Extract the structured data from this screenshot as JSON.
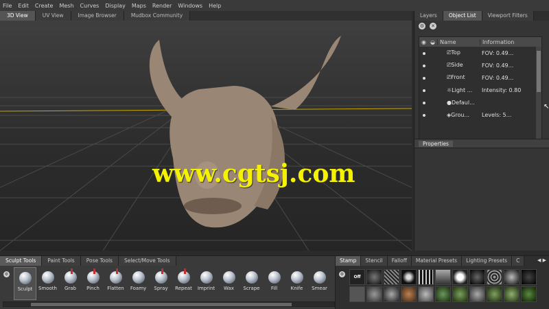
{
  "menu": [
    "File",
    "Edit",
    "Create",
    "Mesh",
    "Curves",
    "Display",
    "Maps",
    "Render",
    "Windows",
    "Help"
  ],
  "viewport_tabs": [
    {
      "label": "3D View",
      "active": true
    },
    {
      "label": "UV View",
      "active": false
    },
    {
      "label": "Image Browser",
      "active": false
    },
    {
      "label": "Mudbox Community",
      "active": false
    }
  ],
  "watermark": "www.cgtsj.com",
  "right_tabs": [
    {
      "label": "Layers",
      "active": false
    },
    {
      "label": "Object List",
      "active": true
    },
    {
      "label": "Viewport Filters",
      "active": false
    }
  ],
  "object_list": {
    "col_name": "Name",
    "col_info": "Information",
    "rows": [
      {
        "name": "Top",
        "info": "FOV: 0.49...",
        "icon": "camera-icon"
      },
      {
        "name": "Side",
        "info": "FOV: 0.49...",
        "icon": "camera-icon"
      },
      {
        "name": "Front",
        "info": "FOV: 0.49...",
        "icon": "camera-icon"
      },
      {
        "name": "Light ...",
        "info": "Intensity: 0.80",
        "icon": "light-icon"
      },
      {
        "name": "Defaul...",
        "info": "",
        "icon": "material-icon"
      },
      {
        "name": "Grou...",
        "info": "Levels: 5...",
        "icon": "mesh-icon"
      }
    ]
  },
  "properties_label": "Properties",
  "tool_tabs": [
    {
      "label": "Sculpt Tools",
      "active": true
    },
    {
      "label": "Paint Tools",
      "active": false
    },
    {
      "label": "Pose Tools",
      "active": false
    },
    {
      "label": "Select/Move Tools",
      "active": false
    }
  ],
  "tools": [
    {
      "label": "Sculpt",
      "active": true
    },
    {
      "label": "Smooth",
      "active": false
    },
    {
      "label": "Grab",
      "active": false
    },
    {
      "label": "Pinch",
      "active": false
    },
    {
      "label": "Flatten",
      "active": false
    },
    {
      "label": "Foamy",
      "active": false
    },
    {
      "label": "Spray",
      "active": false
    },
    {
      "label": "Repeat",
      "active": false
    },
    {
      "label": "Imprint",
      "active": false
    },
    {
      "label": "Wax",
      "active": false
    },
    {
      "label": "Scrape",
      "active": false
    },
    {
      "label": "Fill",
      "active": false
    },
    {
      "label": "Knife",
      "active": false
    },
    {
      "label": "Smear",
      "active": false
    }
  ],
  "stamp_tabs": [
    {
      "label": "Stamp",
      "active": true
    },
    {
      "label": "Stencil",
      "active": false
    },
    {
      "label": "Falloff",
      "active": false
    },
    {
      "label": "Material Presets",
      "active": false
    },
    {
      "label": "Lighting Presets",
      "active": false
    },
    {
      "label": "C",
      "active": false
    }
  ],
  "stamp_off_label": "Off",
  "colors": {
    "accent": "#f4f200",
    "head": "#9a8674"
  }
}
